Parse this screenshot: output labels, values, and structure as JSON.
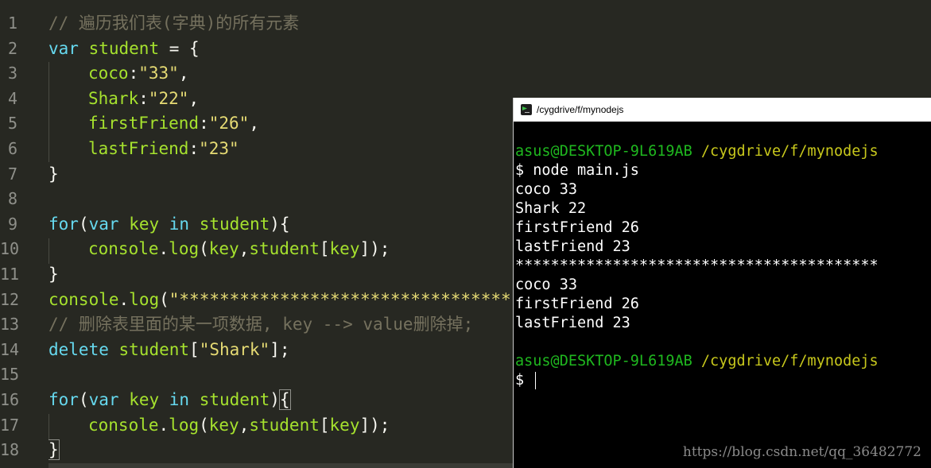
{
  "editor": {
    "line_numbers": [
      "1",
      "2",
      "3",
      "4",
      "5",
      "6",
      "7",
      "8",
      "9",
      "10",
      "11",
      "12",
      "13",
      "14",
      "15",
      "16",
      "17",
      "18"
    ],
    "l1_comment": "// 遍历我们表(字典)的所有元素",
    "l2_kw": "var",
    "l2_name": "student",
    "l2_rest": " = {",
    "l3_key": "coco",
    "l3_colon": ":",
    "l3_val": "\"33\"",
    "l3_comma": ",",
    "l4_key": "Shark",
    "l4_colon": ":",
    "l4_val": "\"22\"",
    "l4_comma": ",",
    "l5_key": "firstFriend",
    "l5_colon": ":",
    "l5_val": "\"26\"",
    "l5_comma": ",",
    "l6_key": "lastFriend",
    "l6_colon": ":",
    "l6_val": "\"23\"",
    "l7_close": "}",
    "l9_for": "for",
    "l9_open": "(",
    "l9_var": "var",
    "l9_key": "key",
    "l9_in": "in",
    "l9_student": "student",
    "l9_close": "){",
    "l10_console": "console",
    "l10_dot": ".",
    "l10_log": "log",
    "l10_args_open": "(",
    "l10_key": "key",
    "l10_comma": ",",
    "l10_student": "student",
    "l10_b1": "[",
    "l10_key2": "key",
    "l10_end": "]);",
    "l11_close": "}",
    "l12_console": "console",
    "l12_dot": ".",
    "l12_log": "log",
    "l12_open": "(",
    "l12_str": "\"*********************************",
    "l13_comment": "// 删除表里面的某一项数据, key --> value删除掉;",
    "l14_kw": "delete",
    "l14_student": "student",
    "l14_b1": "[",
    "l14_str": "\"Shark\"",
    "l14_end": "];",
    "l16_for": "for",
    "l16_open": "(",
    "l16_var": "var",
    "l16_key": "key",
    "l16_in": "in",
    "l16_student": "student",
    "l16_close": ")",
    "l16_brace": "{",
    "l17_console": "console",
    "l17_dot": ".",
    "l17_log": "log",
    "l17_args_open": "(",
    "l17_key": "key",
    "l17_comma": ",",
    "l17_student": "student",
    "l17_b1": "[",
    "l17_key2": "key",
    "l17_end": "]);",
    "l18_close": "}"
  },
  "terminal": {
    "title": "/cygdrive/f/mynodejs",
    "prompt_user": "asus@DESKTOP-9L619AB",
    "prompt_path": "/cygdrive/f/mynodejs",
    "command": "$ node main.js",
    "out1": "coco 33",
    "out2": "Shark 22",
    "out3": "firstFriend 26",
    "out4": "lastFriend 23",
    "separator": "*****************************************",
    "out5": "coco 33",
    "out6": "firstFriend 26",
    "out7": "lastFriend 23",
    "prompt_symbol": "$"
  },
  "watermark": "https://blog.csdn.net/qq_36482772"
}
